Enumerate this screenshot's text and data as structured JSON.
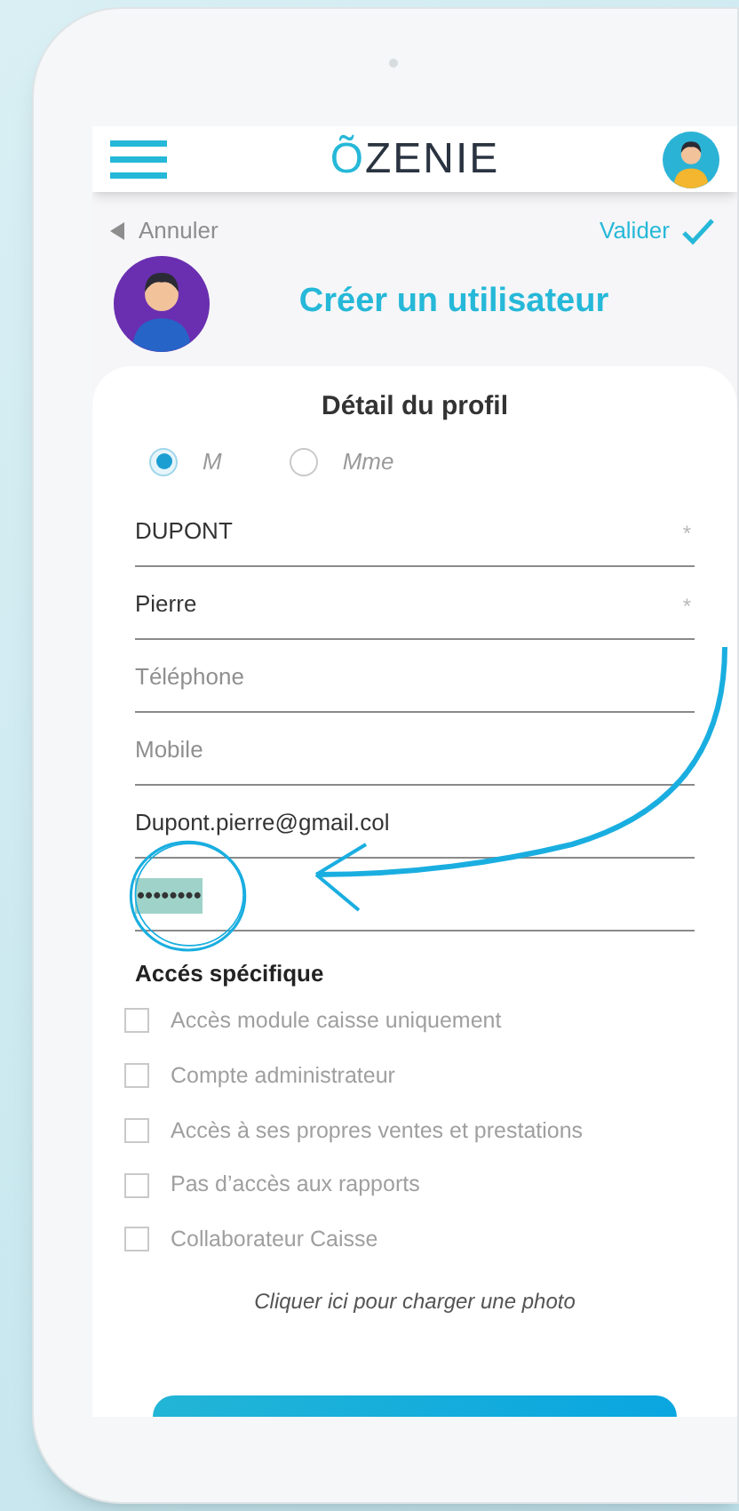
{
  "header": {
    "logo": "ÕZENIE"
  },
  "nav": {
    "back": "Annuler",
    "confirm": "Valider"
  },
  "title": "Créer un utilisateur",
  "card": {
    "heading": "Détail du profil",
    "civility": [
      {
        "label": "M",
        "selected": true
      },
      {
        "label": "Mme",
        "selected": false
      }
    ],
    "fields": [
      {
        "value": "DUPONT",
        "marker": "*"
      },
      {
        "value": "Pierre",
        "marker": "*"
      },
      {
        "placeholder": "Téléphone"
      },
      {
        "placeholder": "Mobile"
      },
      {
        "value": "Dupont.pierre@gmail.col"
      },
      {
        "value": "••••••••",
        "highlighted": true
      }
    ],
    "access_heading": "Accés spécifique",
    "access": [
      {
        "label": "Accès module caisse uniquement",
        "checked": false
      },
      {
        "label": "Compte administrateur",
        "checked": false
      },
      {
        "label": "Accès à ses propres ventes et prestations",
        "checked": false
      },
      {
        "label": "Pas d’accès aux rapports",
        "checked": false
      },
      {
        "label": "Collaborateur Caisse",
        "checked": false
      }
    ],
    "photo_link": "Cliquer ici pour charger une photo"
  }
}
